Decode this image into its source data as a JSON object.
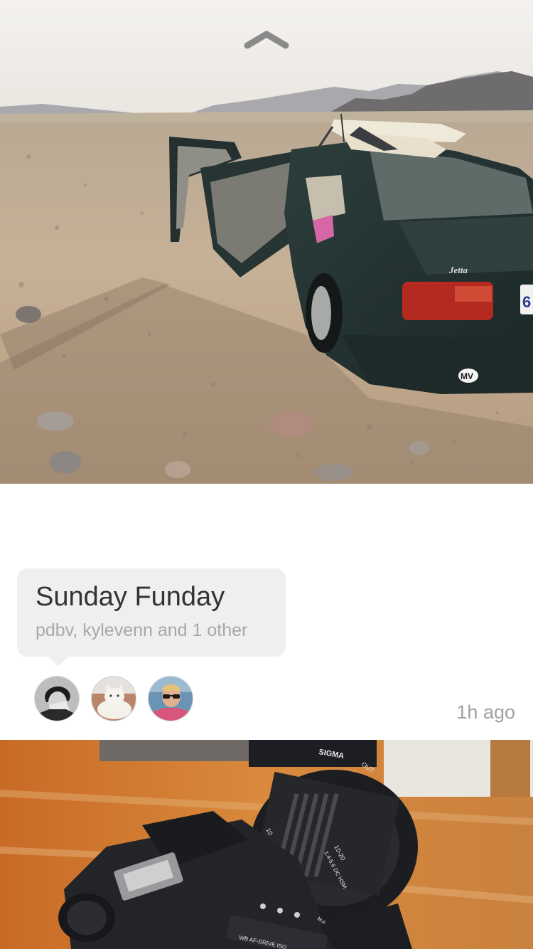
{
  "post": {
    "title": "Sunday Funday",
    "participants": "pdbv, kylevenn and 1 other",
    "time_ago": "1h ago",
    "avatars": [
      {
        "label": "user-1"
      },
      {
        "label": "user-2"
      },
      {
        "label": "user-3"
      }
    ]
  },
  "photo_top": {
    "car_badge": "Jetta",
    "plate_badge": "MV",
    "plate_number": "6"
  },
  "photo_bottom": {
    "lens_brand": "SIGMA",
    "lens_switch": "OUT",
    "lens_spec_1": "10-20",
    "lens_spec_2": "1:4-5.6 DC HSM",
    "lens_focal": "10",
    "body_text_1": "WB AF-DRIVE ISO",
    "body_text_2": "M-Fn"
  },
  "colors": {
    "caption_bg": "#efefef",
    "title_text": "#333333",
    "meta_text": "#a8a8a8"
  }
}
